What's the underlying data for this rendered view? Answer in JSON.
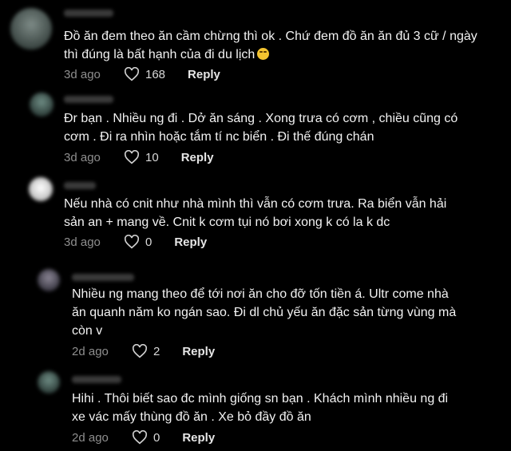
{
  "colors": {
    "background": "#000000",
    "text": "#f2f2f2",
    "meta": "#8e8e8e"
  },
  "comments": [
    {
      "lines": [
        "Đồ ăn đem theo ăn cầm chừng thì ok . Chứ đem đồ ăn ăn đủ 3 cữ / ngày",
        "thì đúng là bất hạnh của đi du lịch"
      ],
      "emoji": "laughing-tears-emoji",
      "time": "3d ago",
      "likes": "168",
      "reply": "Reply"
    },
    {
      "lines": [
        "Đr bạn . Nhiều ng đi . Dở ăn sáng . Xong trưa có cơm , chiều cũng có",
        "cơm . Đi ra nhìn hoặc tắm tí nc biển . Đi thế đúng chán"
      ],
      "time": "3d ago",
      "likes": "10",
      "reply": "Reply"
    },
    {
      "lines": [
        "Nếu nhà có cnit như nhà mình thì vẫn có cơm trưa. Ra biển vẫn hải",
        "sản an + mang về. Cnit k cơm tụi nó bơi xong k có la k dc"
      ],
      "time": "3d ago",
      "likes": "0",
      "reply": "Reply"
    },
    {
      "lines": [
        "Nhiều ng mang theo để tới nơi ăn cho đỡ tốn tiền á. Ultr come nhà",
        "ăn quanh năm ko ngán sao. Đi dl chủ yếu ăn đặc sản từng vùng mà",
        "còn v"
      ],
      "time": "2d ago",
      "likes": "2",
      "reply": "Reply"
    },
    {
      "lines": [
        "Hihi . Thôi biết sao đc mình giống sn bạn . Khách mình nhiều ng đi",
        "xe vác mấy thùng đồ ăn . Xe bỏ đầy đồ ăn"
      ],
      "time": "2d ago",
      "likes": "0",
      "reply": "Reply"
    }
  ]
}
